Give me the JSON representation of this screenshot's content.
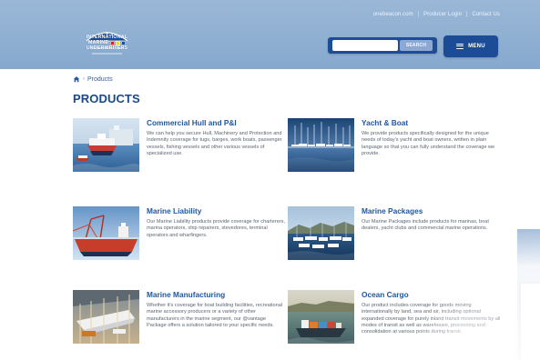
{
  "header": {
    "top_links": [
      "onebeacon.com",
      "Producer Login",
      "Contact Us"
    ],
    "logo": {
      "line_1": "INTERNATIONAL",
      "line_2_left": "MARINE",
      "line_3": "UNDERWRITERS"
    },
    "search": {
      "placeholder": "",
      "button_label": "SEARCH"
    },
    "menu": {
      "label": "MENU",
      "icon": "menu-icon"
    }
  },
  "breadcrumb": {
    "home_icon": "home-icon",
    "current": "Products"
  },
  "main": {
    "title": "PRODUCTS",
    "products": [
      {
        "title": "Commercial Hull and P&I",
        "description": "We can help you secure Hull, Machinery and Protection and Indemnity coverage for tugs, barges, work boats, passenger vessels, fishing vessels and other various vessels of specialized use."
      },
      {
        "title": "Yacht & Boat",
        "description": "We provide products specifically designed for the unique needs of today's yacht and boat owners, written in plain language so that you can fully understand the coverage we provide."
      },
      {
        "title": "Marine Liability",
        "description": "Our Marine Liability products provide coverage for charterers, marina operators, ship repairers, stevedores, terminal operators and wharfingers."
      },
      {
        "title": "Marine Packages",
        "description": "Our Marine Packages include products for marinas, boat dealers, yacht clubs and commercial marine operations."
      },
      {
        "title": "Marine Manufacturing",
        "description": "Whether it's coverage for boat building facilities, recreational marine accessory producers or a variety of other manufacturers in the marine segment, our @vantage Package offers a solution tailored to your specific needs."
      },
      {
        "title": "Ocean Cargo",
        "description": "Our product includes coverage for goods moving internationally by land, sea and air, including optional expanded coverage for purely inland transit movements by all modes of transit as well as warehouse, processing and consolidation at various points during transit."
      }
    ]
  },
  "colors": {
    "header_blue": "#8fb0d2",
    "brand_navy": "#1d4c96",
    "link_blue": "#1f57a1",
    "body_text": "#5b6674",
    "title_blue": "#18488f"
  }
}
